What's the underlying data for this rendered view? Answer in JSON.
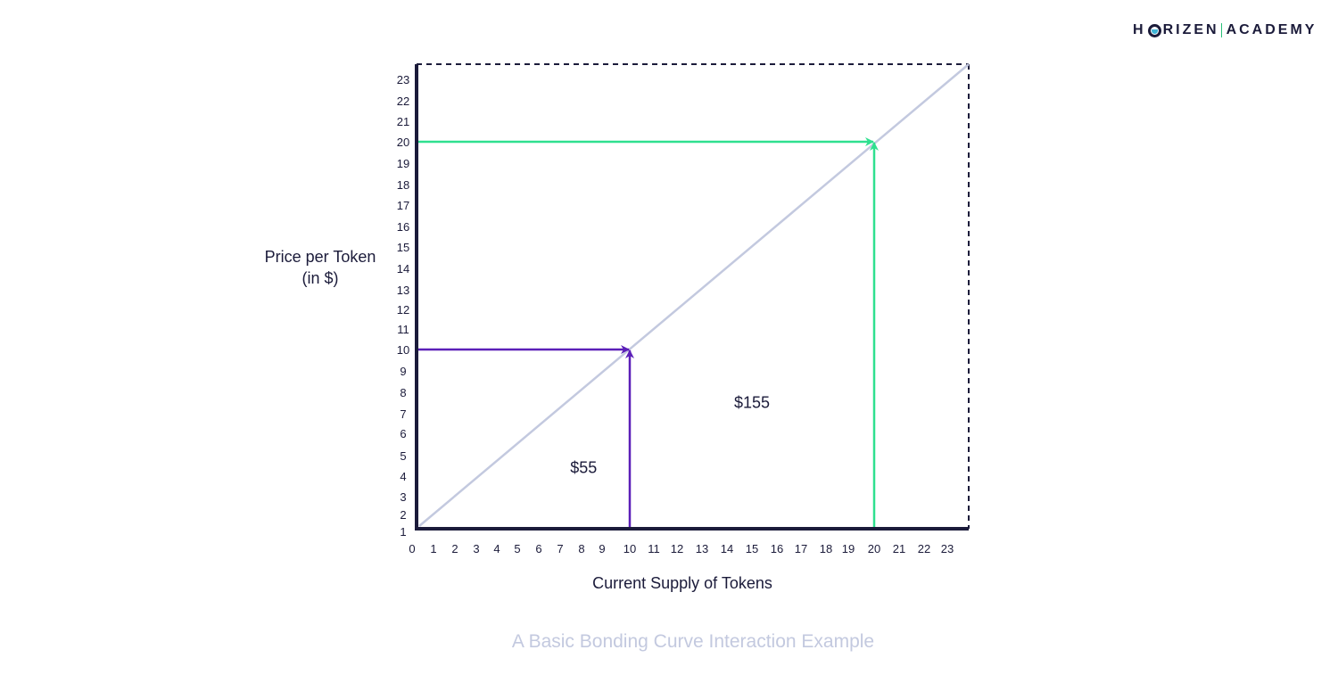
{
  "brand": {
    "logo_left": "H",
    "logo_icon": "horizen-o-icon",
    "logo_right": "RIZEN",
    "logo_suffix": "ACADEMY"
  },
  "chart_data": {
    "type": "line",
    "title": "",
    "caption": "A Basic Bonding Curve Interaction Example",
    "xlabel": "Current Supply of Tokens",
    "ylabel_line1": "Price per Token",
    "ylabel_line2": "(in $)",
    "x_ticks": [
      "0",
      "1",
      "2",
      "3",
      "4",
      "5",
      "6",
      "7",
      "8",
      "9",
      "10",
      "11",
      "12",
      "13",
      "14",
      "15",
      "16",
      "17",
      "18",
      "19",
      "20",
      "21",
      "22",
      "23"
    ],
    "y_ticks": [
      "1",
      "2",
      "3",
      "4",
      "5",
      "6",
      "7",
      "8",
      "9",
      "10",
      "11",
      "12",
      "13",
      "14",
      "15",
      "16",
      "17",
      "18",
      "19",
      "20",
      "21",
      "22",
      "23"
    ],
    "xlim": [
      0,
      23.8
    ],
    "ylim": [
      0,
      23.8
    ],
    "grid": false,
    "series": [
      {
        "name": "bonding-curve",
        "color": "#c3c9df",
        "x": [
          0,
          23.8
        ],
        "y": [
          0,
          23.8
        ]
      }
    ],
    "annotations": [
      {
        "name": "purchase-10",
        "color": "#5b1fb8",
        "x": 10,
        "y": 10,
        "area_label": "$55",
        "area_label_pos": [
          7,
          3
        ]
      },
      {
        "name": "purchase-20",
        "color": "#2fe08f",
        "x": 20,
        "y": 20,
        "area_label": "$155",
        "area_label_pos": [
          15,
          7
        ]
      }
    ],
    "colors": {
      "axis": "#1b1b3a",
      "dashed_frame": "#1b1b3a"
    }
  }
}
